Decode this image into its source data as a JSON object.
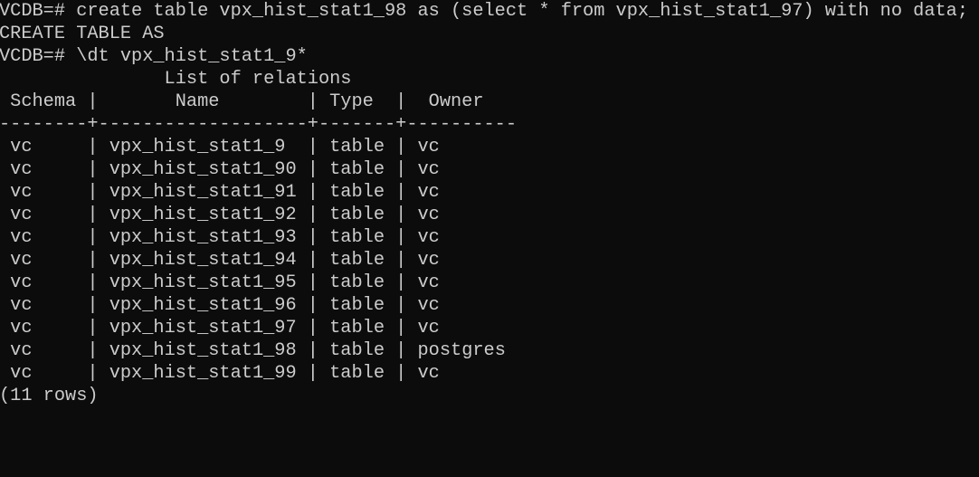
{
  "terminal": {
    "background": "#0c0c0c",
    "foreground": "#cccccc",
    "lines": {
      "command1": "VCDB=# create table vpx_hist_stat1_98 as (select * from vpx_hist_stat1_97) with no data;",
      "result1": "CREATE TABLE AS",
      "command2": "VCDB=# \\dt vpx_hist_stat1_9*"
    },
    "table": {
      "title": "               List of relations",
      "header": " Schema |       Name        | Type  |  Owner",
      "separator": "--------+-------------------+-------+----------",
      "columns": [
        "Schema",
        "Name",
        "Type",
        "Owner"
      ],
      "rows": [
        {
          "schema": "vc",
          "name": "vpx_hist_stat1_9",
          "type": "table",
          "owner": "vc"
        },
        {
          "schema": "vc",
          "name": "vpx_hist_stat1_90",
          "type": "table",
          "owner": "vc"
        },
        {
          "schema": "vc",
          "name": "vpx_hist_stat1_91",
          "type": "table",
          "owner": "vc"
        },
        {
          "schema": "vc",
          "name": "vpx_hist_stat1_92",
          "type": "table",
          "owner": "vc"
        },
        {
          "schema": "vc",
          "name": "vpx_hist_stat1_93",
          "type": "table",
          "owner": "vc"
        },
        {
          "schema": "vc",
          "name": "vpx_hist_stat1_94",
          "type": "table",
          "owner": "vc"
        },
        {
          "schema": "vc",
          "name": "vpx_hist_stat1_95",
          "type": "table",
          "owner": "vc"
        },
        {
          "schema": "vc",
          "name": "vpx_hist_stat1_96",
          "type": "table",
          "owner": "vc"
        },
        {
          "schema": "vc",
          "name": "vpx_hist_stat1_97",
          "type": "table",
          "owner": "vc"
        },
        {
          "schema": "vc",
          "name": "vpx_hist_stat1_98",
          "type": "table",
          "owner": "postgres"
        },
        {
          "schema": "vc",
          "name": "vpx_hist_stat1_99",
          "type": "table",
          "owner": "vc"
        }
      ],
      "footer": "(11 rows)"
    }
  }
}
